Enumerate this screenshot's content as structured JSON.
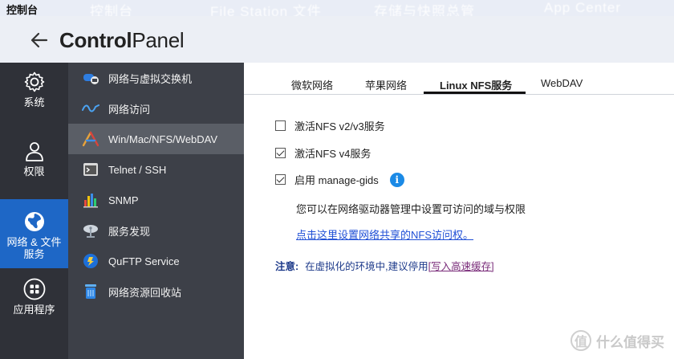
{
  "topbar": {
    "active": "控制台",
    "tabs": [
      "控制台",
      "File Station 文件",
      "存储与快照总管",
      "App Center"
    ]
  },
  "header": {
    "title_bold": "Control",
    "title_rest": "Panel"
  },
  "rail": {
    "items": [
      {
        "label": "系统",
        "icon": "gear-icon"
      },
      {
        "label": "权限",
        "icon": "user-icon"
      },
      {
        "label": "网络 & 文件\n服务",
        "icon": "globe-icon",
        "active": true
      },
      {
        "label": "应用程序",
        "icon": "apps-icon"
      }
    ]
  },
  "menu": {
    "items": [
      {
        "label": "网络与虚拟交换机",
        "icon": "network-switch-icon"
      },
      {
        "label": "网络访问",
        "icon": "network-access-icon"
      },
      {
        "label": "Win/Mac/NFS/WebDAV",
        "icon": "file-sharing-icon",
        "active": true
      },
      {
        "label": "Telnet / SSH",
        "icon": "terminal-icon"
      },
      {
        "label": "SNMP",
        "icon": "snmp-chart-icon"
      },
      {
        "label": "服务发现",
        "icon": "satellite-dish-icon"
      },
      {
        "label": "QuFTP Service",
        "icon": "ftp-icon"
      },
      {
        "label": "网络资源回收站",
        "icon": "recycle-bin-icon"
      }
    ]
  },
  "tabs": [
    {
      "label": "微软网络"
    },
    {
      "label": "苹果网络"
    },
    {
      "label": "Linux NFS服务",
      "active": true
    },
    {
      "label": "WebDAV"
    }
  ],
  "options": {
    "nfs_v2v3": {
      "label": "激活NFS v2/v3服务",
      "checked": false
    },
    "nfs_v4": {
      "label": "激活NFS v4服务",
      "checked": true
    },
    "manage_gids": {
      "label": "启用 manage-gids",
      "checked": true
    }
  },
  "description": "您可以在网络驱动器管理中设置可访问的域与权限",
  "link": "点击这里设置网络共享的NFS访问权。",
  "note": {
    "key": "注意:",
    "message": "在虚拟化的环境中,建议停用",
    "cache_link": "[写入高速缓存]"
  },
  "watermark": {
    "symbol": "值",
    "text": "什么值得买"
  },
  "colors": {
    "accent": "#1e67c6",
    "link": "#1f4fd6",
    "info": "#1b8ae6"
  }
}
